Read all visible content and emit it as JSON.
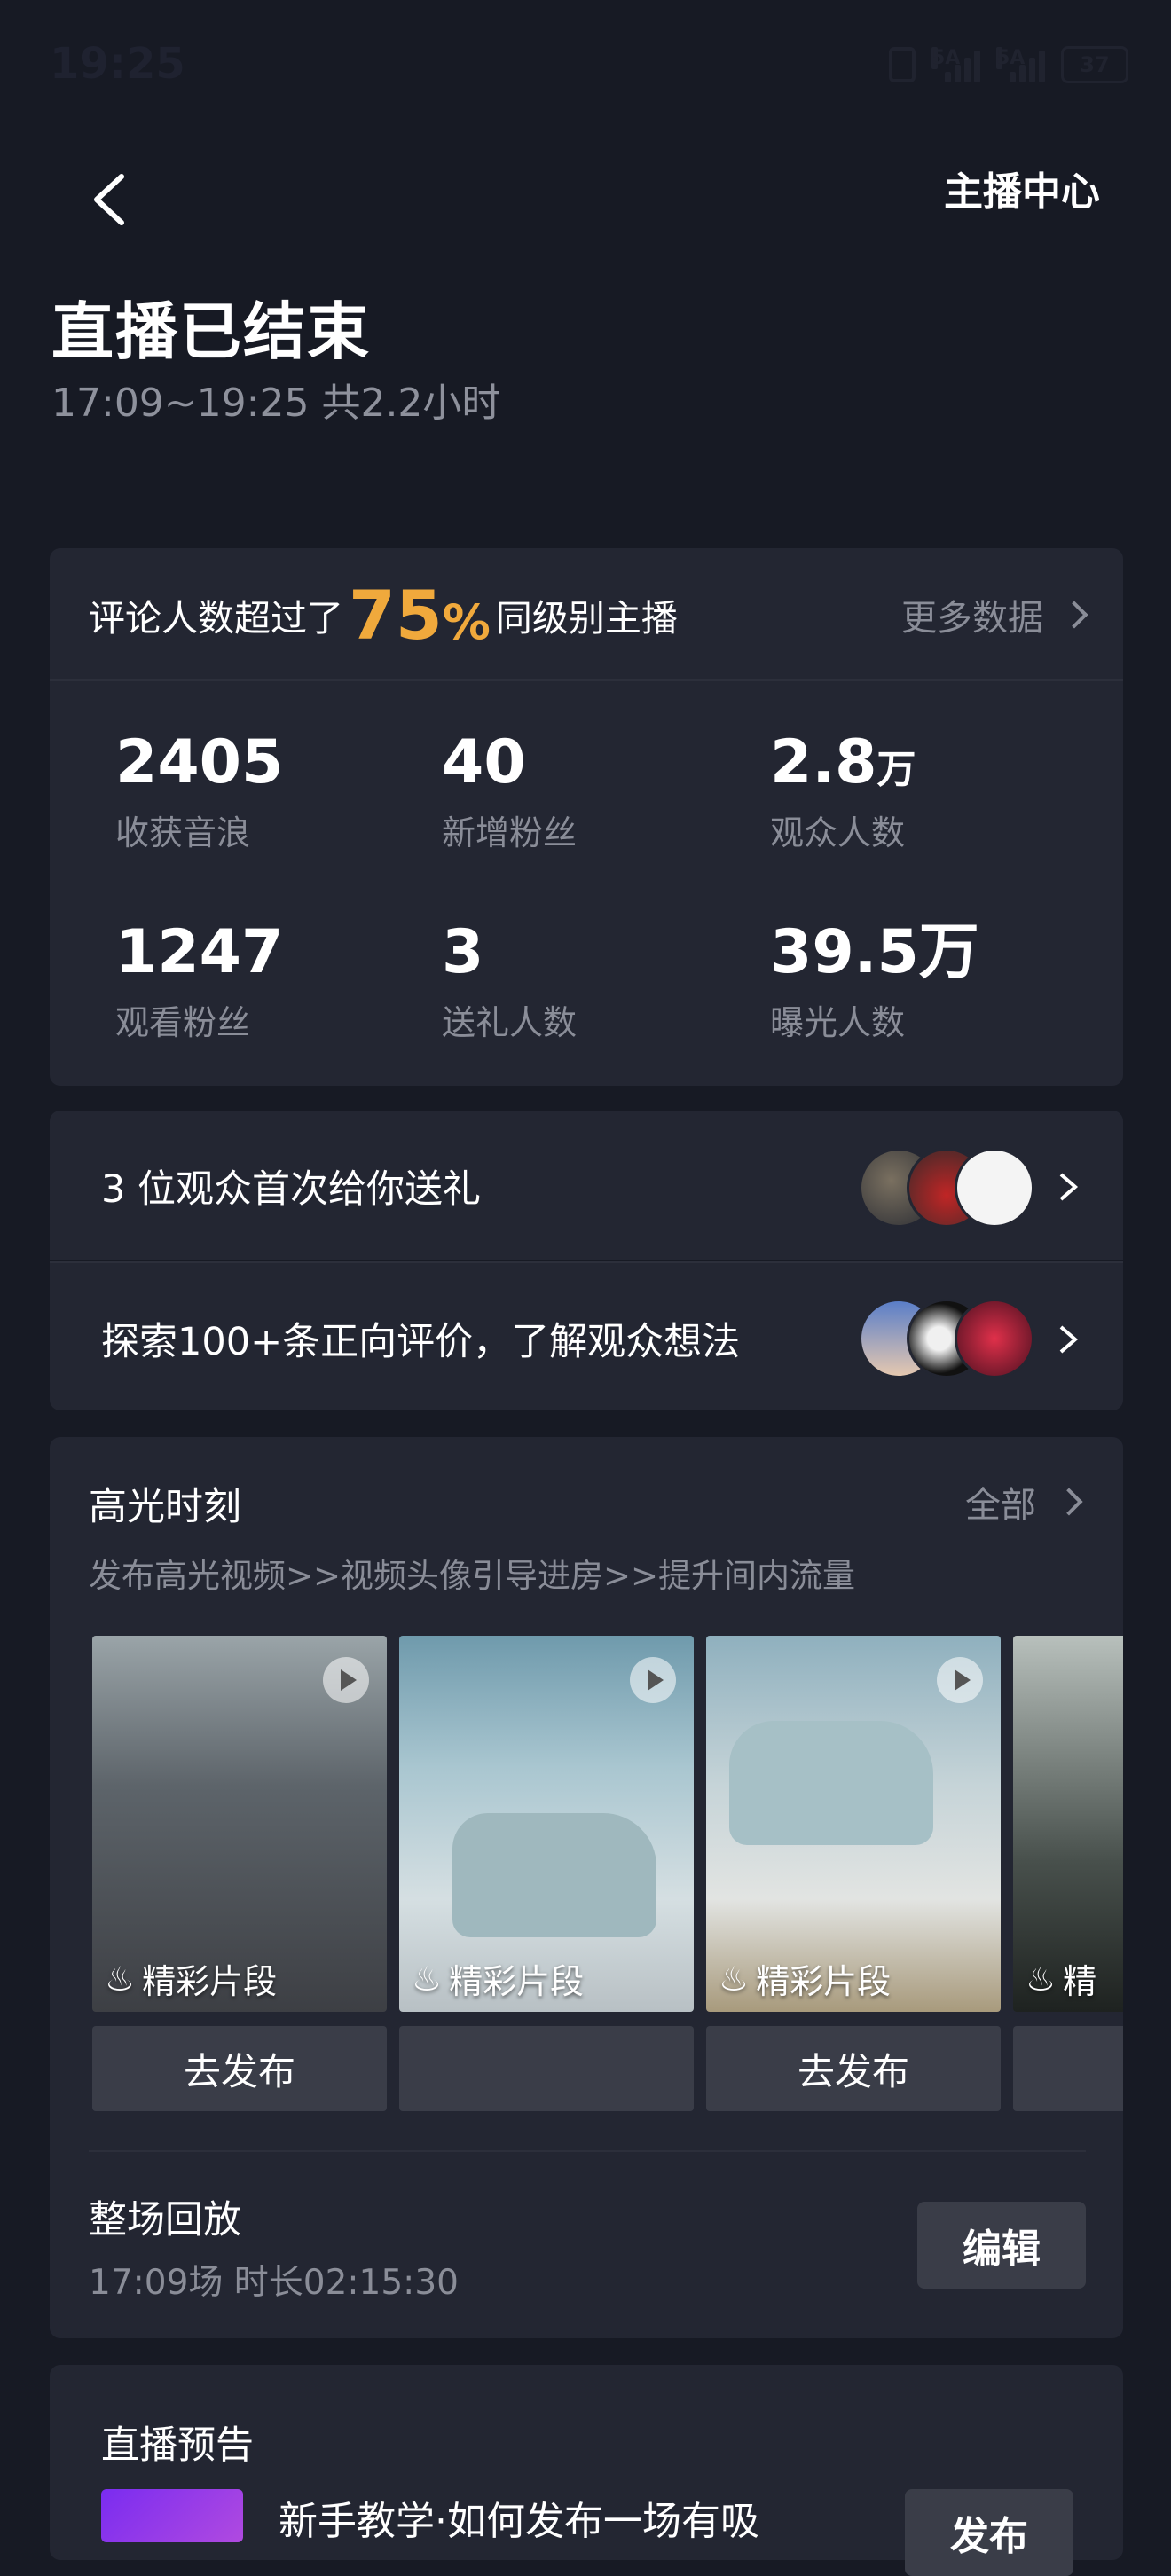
{
  "status_bar": {
    "time": "19:25",
    "network1": "5A",
    "network2": "5A",
    "battery": "37"
  },
  "header": {
    "back_icon": "chevron-left-icon",
    "right_label": "主播中心"
  },
  "summary": {
    "title": "直播已结束",
    "subtitle": "17:09~19:25 共2.2小时"
  },
  "comparison": {
    "prefix": "评论人数超过了",
    "percent_value": "75",
    "percent_sign": "%",
    "suffix": "同级别主播",
    "more_label": "更多数据"
  },
  "stats": [
    {
      "value": "2405",
      "unit": "",
      "label": "收获音浪"
    },
    {
      "value": "40",
      "unit": "",
      "label": "新增粉丝"
    },
    {
      "value": "2.8",
      "unit": "万",
      "label": "观众人数"
    },
    {
      "value": "1247",
      "unit": "",
      "label": "观看粉丝"
    },
    {
      "value": "3",
      "unit": "",
      "label": "送礼人数"
    },
    {
      "value": "39.5万",
      "unit": "",
      "label": "曝光人数"
    }
  ],
  "gift_row": {
    "label": "3 位观众首次给你送礼"
  },
  "review_row": {
    "label": "探索100+条正向评价，了解观众想法"
  },
  "highlights": {
    "title": "高光时刻",
    "all_label": "全部",
    "subtitle": "发布高光视频>>视频头像引导进房>>提升间内流量",
    "clips": [
      {
        "caption": "精彩片段",
        "button": "去发布"
      },
      {
        "caption": "精彩片段",
        "button": ""
      },
      {
        "caption": "精彩片段",
        "button": "去发布"
      },
      {
        "caption": "精",
        "button": ""
      }
    ]
  },
  "replay": {
    "title": "整场回放",
    "meta": "17:09场 时长02:15:30",
    "edit_label": "编辑"
  },
  "preview": {
    "title": "直播预告",
    "tutorial": "新手教学·如何发布一场有吸",
    "publish_label": "发布"
  }
}
